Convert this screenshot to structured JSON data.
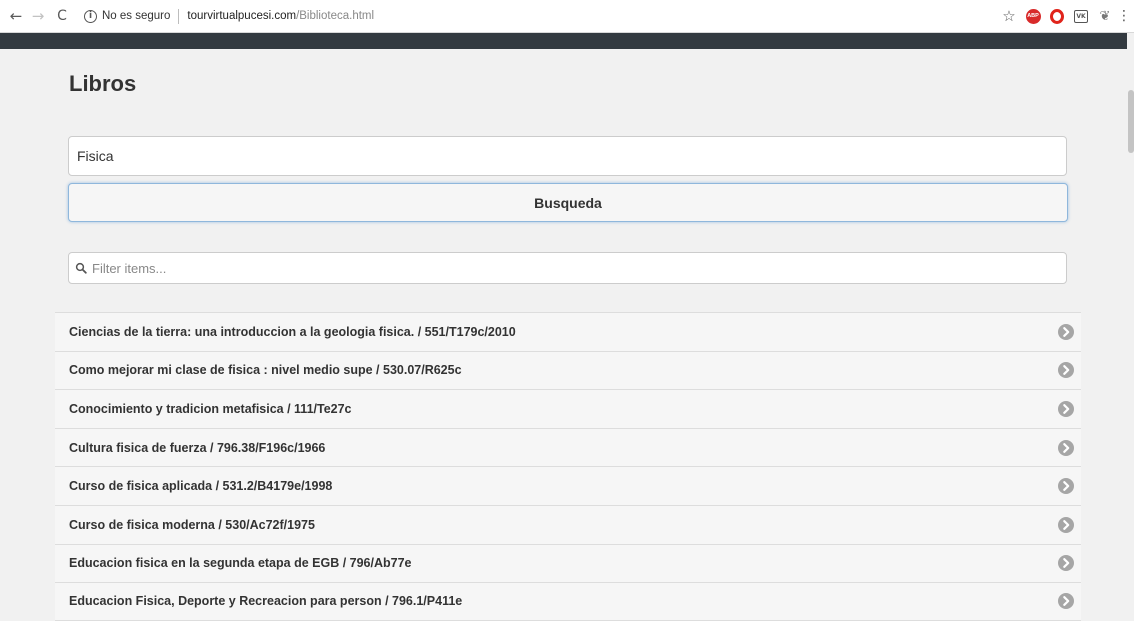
{
  "browser": {
    "back_glyph": "←",
    "forward_glyph": "→",
    "reload_glyph": "C",
    "info_glyph": "i",
    "security_label": "No es seguro",
    "url_host": "tourvirtualpucesi.com",
    "url_path": "/Biblioteca.html",
    "extensions": {
      "star_glyph": "☆",
      "abp_label": "ABP",
      "vk_label": "VK",
      "feather_glyph": "❦",
      "menu_glyph": "⋮"
    }
  },
  "page": {
    "title": "Libros",
    "search": {
      "value": "Fisica",
      "button_label": "Busqueda"
    },
    "filter": {
      "placeholder": "Filter items..."
    },
    "results": [
      {
        "label": "Ciencias de la tierra: una introduccion a la geologia fisica. / 551/T179c/2010"
      },
      {
        "label": "Como mejorar mi clase de fisica : nivel medio supe / 530.07/R625c"
      },
      {
        "label": "Conocimiento y tradicion metafisica / 111/Te27c"
      },
      {
        "label": "Cultura fisica de fuerza / 796.38/F196c/1966"
      },
      {
        "label": "Curso de fisica aplicada / 531.2/B4179e/1998"
      },
      {
        "label": "Curso de fisica moderna / 530/Ac72f/1975"
      },
      {
        "label": "Educacion fisica en la segunda etapa de EGB / 796/Ab77e"
      },
      {
        "label": "Educacion Fisica, Deporte y Recreacion para person / 796.1/P411e"
      }
    ]
  },
  "colors": {
    "topbar": "#333a40",
    "list_bg": "#f6f6f6",
    "arrow": "#a6a6a6",
    "focus": "#8fb7dc"
  }
}
